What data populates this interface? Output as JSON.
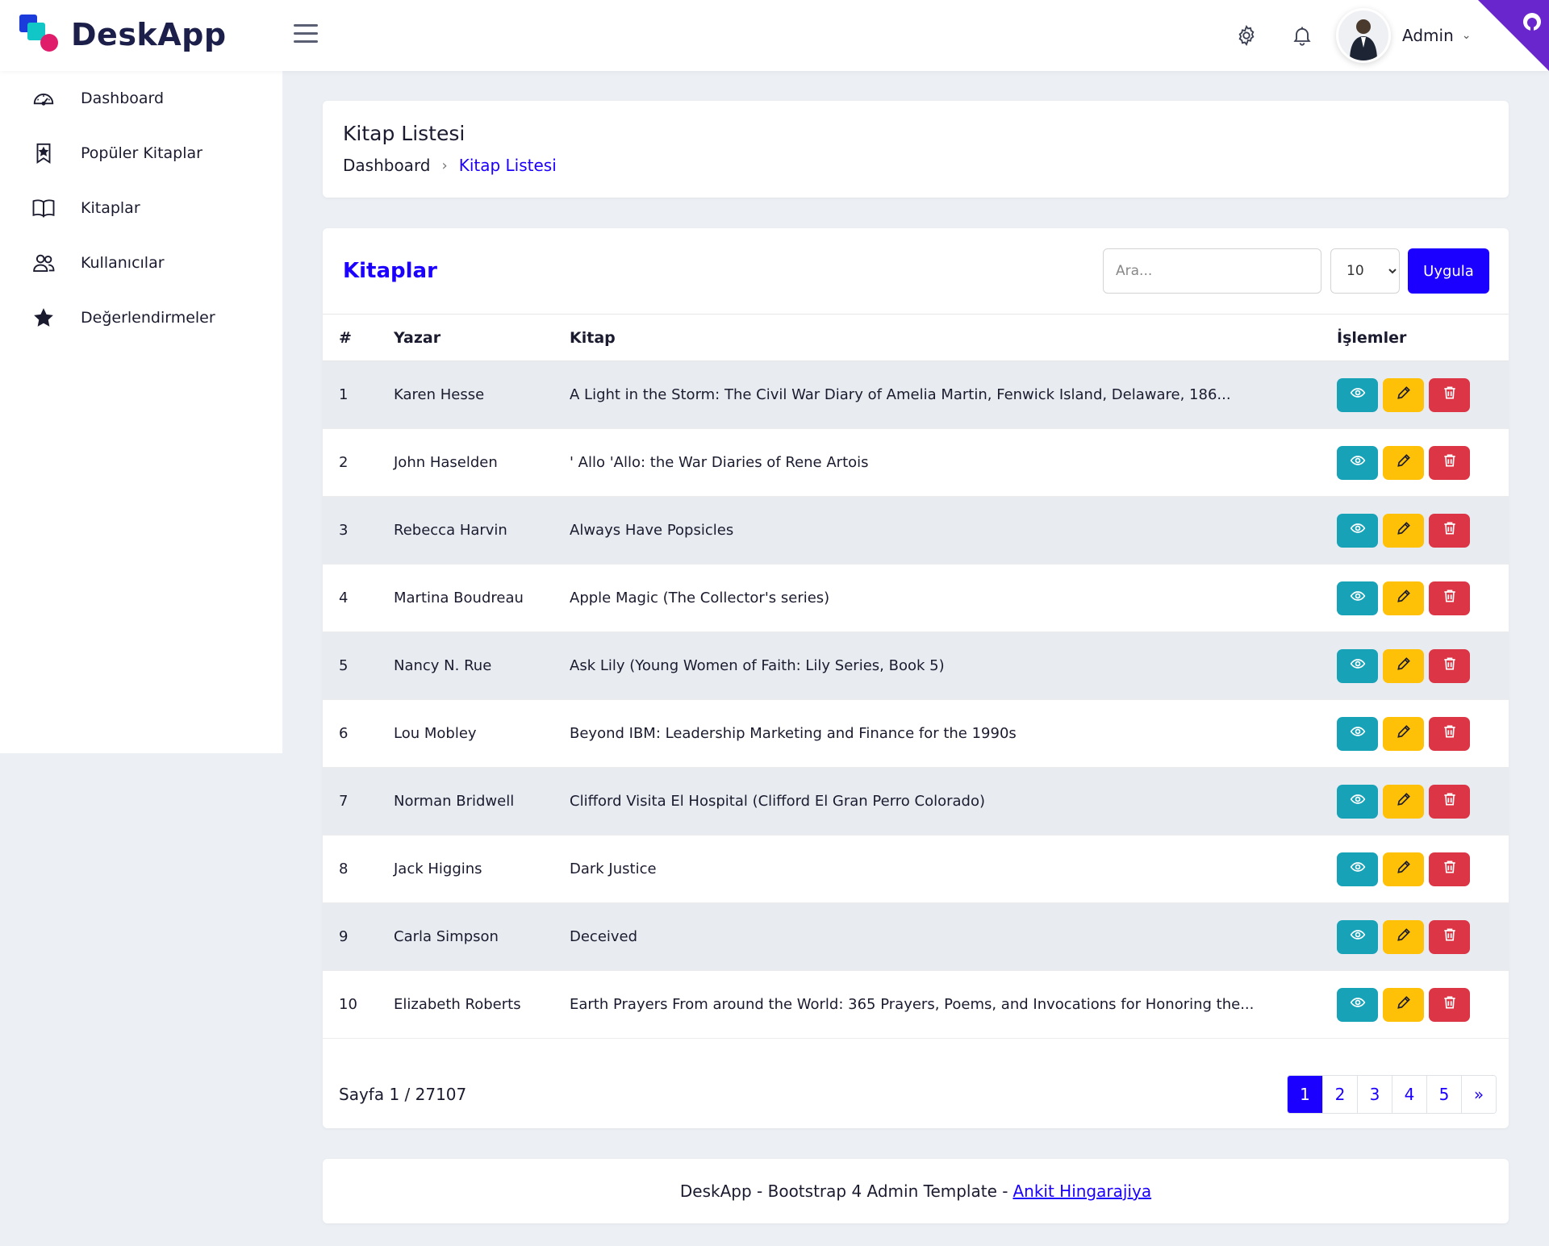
{
  "brand": {
    "name": "DeskApp"
  },
  "header": {
    "user_name": "Admin"
  },
  "sidebar": {
    "items": [
      {
        "label": "Dashboard",
        "icon": "speedometer-icon"
      },
      {
        "label": "Popüler Kitaplar",
        "icon": "bookmark-star-icon"
      },
      {
        "label": "Kitaplar",
        "icon": "open-book-icon"
      },
      {
        "label": "Kullanıcılar",
        "icon": "users-icon"
      },
      {
        "label": "Değerlendirmeler",
        "icon": "star-icon"
      }
    ]
  },
  "page": {
    "title": "Kitap Listesi",
    "breadcrumb": {
      "home": "Dashboard",
      "separator": "›",
      "current": "Kitap Listesi"
    }
  },
  "table_card": {
    "title": "Kitaplar",
    "search_placeholder": "Ara...",
    "page_size": "10",
    "apply_label": "Uygula",
    "columns": [
      "#",
      "Yazar",
      "Kitap",
      "İşlemler"
    ],
    "rows": [
      {
        "num": "1",
        "author": "Karen Hesse",
        "book": "A Light in the Storm: The Civil War Diary of Amelia Martin, Fenwick Island, Delaware, 186..."
      },
      {
        "num": "2",
        "author": "John Haselden",
        "book": "' Allo 'Allo: the War Diaries of Rene Artois"
      },
      {
        "num": "3",
        "author": "Rebecca Harvin",
        "book": "Always Have Popsicles"
      },
      {
        "num": "4",
        "author": "Martina Boudreau",
        "book": "Apple Magic (The Collector's series)"
      },
      {
        "num": "5",
        "author": "Nancy N. Rue",
        "book": "Ask Lily (Young Women of Faith: Lily Series, Book 5)"
      },
      {
        "num": "6",
        "author": "Lou Mobley",
        "book": "Beyond IBM: Leadership Marketing and Finance for the 1990s"
      },
      {
        "num": "7",
        "author": "Norman Bridwell",
        "book": "Clifford Visita El Hospital (Clifford El Gran Perro Colorado)"
      },
      {
        "num": "8",
        "author": "Jack Higgins",
        "book": "Dark Justice"
      },
      {
        "num": "9",
        "author": "Carla Simpson",
        "book": "Deceived"
      },
      {
        "num": "10",
        "author": "Elizabeth Roberts",
        "book": "Earth Prayers From around the World: 365 Prayers, Poems, and Invocations for Honoring the..."
      }
    ],
    "page_info": "Sayfa 1 / 27107",
    "pagination": [
      "1",
      "2",
      "3",
      "4",
      "5",
      "»"
    ],
    "active_page": "1"
  },
  "footer": {
    "text": "DeskApp - Bootstrap 4 Admin Template -",
    "link": "Ankit Hingarajiya"
  },
  "colors": {
    "accent": "#1b00ff",
    "view": "#17a2b8",
    "edit": "#ffc107",
    "delete": "#dc3545",
    "github_corner": "#6a26cd"
  }
}
